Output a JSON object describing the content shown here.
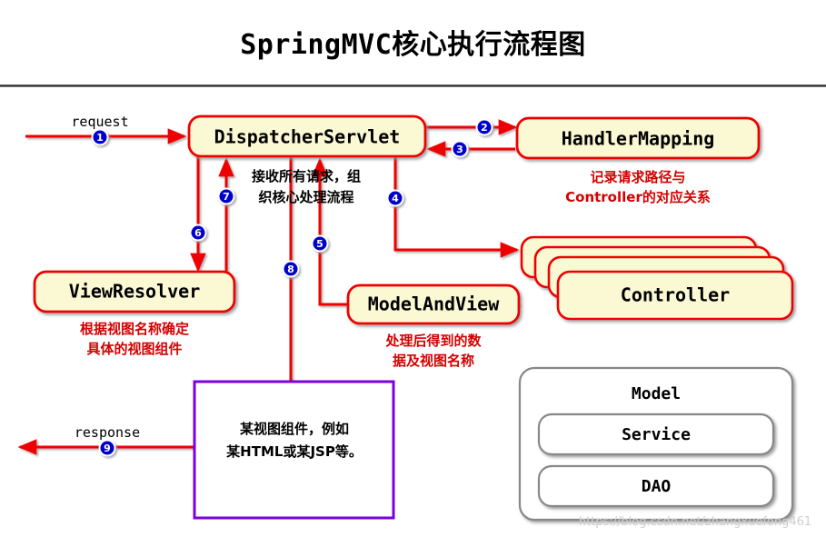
{
  "title": "SpringMVC核心执行流程图",
  "nodes": {
    "dispatcher": {
      "label": "DispatcherServlet",
      "caption_line1": "接收所有请求，组",
      "caption_line2": "织核心处理流程"
    },
    "handler_mapping": {
      "label": "HandlerMapping",
      "caption_line1": "记录请求路径与",
      "caption_line2": "Controller的对应关系"
    },
    "view_resolver": {
      "label": "ViewResolver",
      "caption_line1": "根据视图名称确定",
      "caption_line2": "具体的视图组件"
    },
    "model_and_view": {
      "label": "ModelAndView",
      "caption_line1": "处理后得到的数",
      "caption_line2": "据及视图名称"
    },
    "controller": {
      "label": "Controller"
    },
    "model": {
      "label": "Model"
    },
    "service": {
      "label": "Service"
    },
    "dao": {
      "label": "DAO"
    },
    "view_component": {
      "line1": "某视图组件，例如",
      "line2": "某HTML或某JSP等。"
    }
  },
  "edges": {
    "request_label": "request",
    "response_label": "response",
    "steps": [
      "1",
      "2",
      "3",
      "4",
      "5",
      "6",
      "7",
      "8",
      "9"
    ]
  },
  "watermark": "https://blog.csdn.net/zhangxuefong461",
  "colors": {
    "node_fill": "#fbf8d4",
    "node_stroke": "#ee0000",
    "flow_red": "#ee0000",
    "badge_blue": "#0000cc",
    "badge_ring": "#ffffff",
    "view_box_stroke": "#7b00e0",
    "model_stroke": "#888888",
    "caption_red": "#d40000",
    "title_black": "#000000"
  }
}
